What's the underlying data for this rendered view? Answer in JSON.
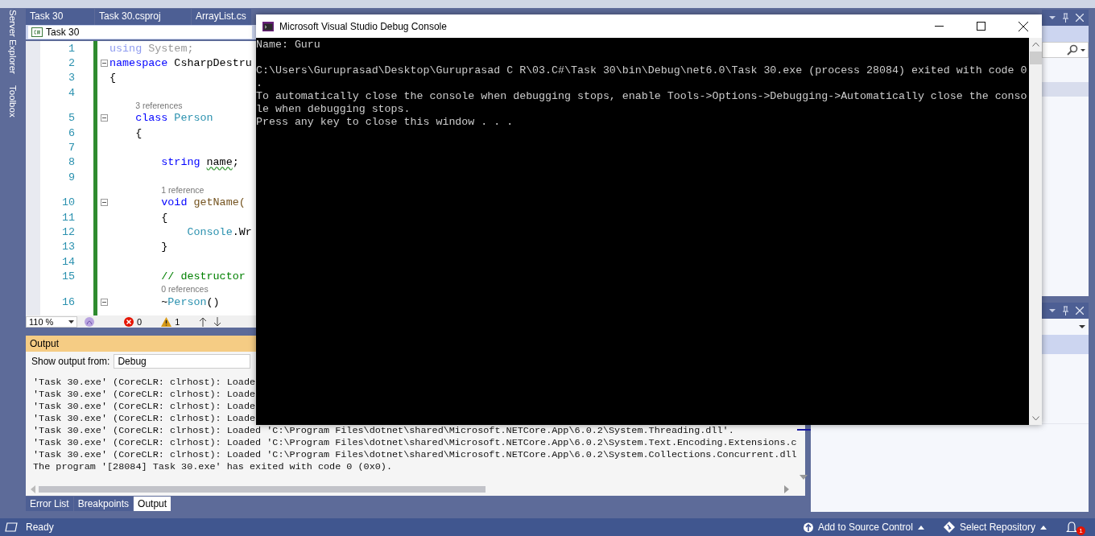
{
  "side_tabs": [
    "Server Explorer",
    "Toolbox"
  ],
  "doc_tabs": [
    {
      "label": "Task 30",
      "selected": false
    },
    {
      "label": "Task 30.csproj",
      "selected": false
    },
    {
      "label": "ArrayList.cs",
      "selected": false
    }
  ],
  "nav_bar": {
    "project": "Task 30"
  },
  "code": [
    {
      "kind": "code",
      "number": "1",
      "foldable": false,
      "tokens": [
        {
          "text": "using",
          "kind": "faded-keyword"
        },
        {
          "text": " System;",
          "kind": "faded"
        }
      ]
    },
    {
      "kind": "code",
      "number": "2",
      "foldable": true,
      "tokens": [
        {
          "text": "namespace",
          "kind": "keyword"
        },
        {
          "text": " CsharpDestru",
          "kind": "plain"
        }
      ]
    },
    {
      "kind": "code",
      "number": "3",
      "foldable": false,
      "tokens": [
        {
          "text": "{",
          "kind": "plain"
        }
      ]
    },
    {
      "kind": "code",
      "number": "4",
      "foldable": false
    },
    {
      "kind": "lens",
      "text": "3 references"
    },
    {
      "kind": "code",
      "number": "5",
      "foldable": true,
      "tokens": [
        {
          "text": "    class",
          "kind": "keyword"
        },
        {
          "text": " Person",
          "kind": "type"
        }
      ]
    },
    {
      "kind": "code",
      "number": "6",
      "foldable": false,
      "tokens": [
        {
          "text": "    {",
          "kind": "plain"
        }
      ]
    },
    {
      "kind": "code",
      "number": "7",
      "foldable": false
    },
    {
      "kind": "code",
      "number": "8",
      "foldable": false,
      "tokens": [
        {
          "text": "        string ",
          "kind": "keyword"
        },
        {
          "text": "name",
          "kind": "warning"
        },
        {
          "text": ";",
          "kind": "plain"
        }
      ]
    },
    {
      "kind": "code",
      "number": "9",
      "foldable": false
    },
    {
      "kind": "lens",
      "text": "1 reference"
    },
    {
      "kind": "code",
      "number": "10",
      "foldable": true,
      "tokens": [
        {
          "text": "        void",
          "kind": "keyword"
        },
        {
          "text": " getName(",
          "kind": "method"
        }
      ]
    },
    {
      "kind": "code",
      "number": "11",
      "foldable": false,
      "tokens": [
        {
          "text": "        {",
          "kind": "plain"
        }
      ]
    },
    {
      "kind": "code",
      "number": "12",
      "foldable": false,
      "tokens": [
        {
          "text": "            Console",
          "kind": "type"
        },
        {
          "text": ".Wr",
          "kind": "plain"
        }
      ]
    },
    {
      "kind": "code",
      "number": "13",
      "foldable": false,
      "tokens": [
        {
          "text": "        }",
          "kind": "plain"
        }
      ]
    },
    {
      "kind": "code",
      "number": "14",
      "foldable": false
    },
    {
      "kind": "code",
      "number": "15",
      "foldable": false,
      "tokens": [
        {
          "text": "        // destructor",
          "kind": "comment"
        }
      ]
    },
    {
      "kind": "lens",
      "text": "0 references"
    },
    {
      "kind": "code",
      "number": "16",
      "foldable": true,
      "tokens": [
        {
          "text": "        ~",
          "kind": "plain"
        },
        {
          "text": "Person",
          "kind": "type"
        },
        {
          "text": "()",
          "kind": "plain"
        }
      ]
    }
  ],
  "editor_status": {
    "zoom": "110 %",
    "errors": "0",
    "warnings": "1"
  },
  "output": {
    "title": "Output",
    "source_label": "Show output from:",
    "source": "Debug",
    "lines": [
      "'Task 30.exe' (CoreCLR: clrhost): Loade",
      "'Task 30.exe' (CoreCLR: clrhost): Loade",
      "'Task 30.exe' (CoreCLR: clrhost): Loade",
      "'Task 30.exe' (CoreCLR: clrhost): Loade",
      "'Task 30.exe' (CoreCLR: clrhost): Loaded 'C:\\Program Files\\dotnet\\shared\\Microsoft.NETCore.App\\6.0.2\\System.Threading.dll'.",
      "'Task 30.exe' (CoreCLR: clrhost): Loaded 'C:\\Program Files\\dotnet\\shared\\Microsoft.NETCore.App\\6.0.2\\System.Text.Encoding.Extensions.c",
      "'Task 30.exe' (CoreCLR: clrhost): Loaded 'C:\\Program Files\\dotnet\\shared\\Microsoft.NETCore.App\\6.0.2\\System.Collections.Concurrent.dll",
      "The program '[28084] Task 30.exe' has exited with code 0 (0x0)."
    ]
  },
  "bottom_tabs": [
    {
      "label": "Error List",
      "selected": false
    },
    {
      "label": "Breakpoints",
      "selected": false
    },
    {
      "label": "Output",
      "selected": true
    }
  ],
  "status_bar": {
    "state": "Ready",
    "source_control": "Add to Source Control",
    "repository": "Select Repository",
    "notifications": "1"
  },
  "console": {
    "title": "Microsoft Visual Studio Debug Console",
    "paragraphs": [
      [
        "Name: Guru"
      ],
      [
        "C:\\Users\\Guruprasad\\Desktop\\Guruprasad C R\\03.C#\\Task 30\\bin\\Debug\\net6.0\\Task 30.exe (process 28084) exited with code 0",
        ".",
        "To automatically close the console when debugging stops, enable Tools->Options->Debugging->Automatically close the conso",
        "le when debugging stops.",
        "Press any key to close this window . . ."
      ]
    ]
  }
}
